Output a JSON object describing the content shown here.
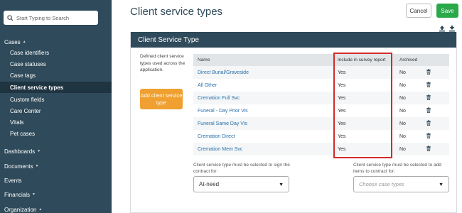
{
  "sidebar": {
    "search_placeholder": "Start Typing to Search",
    "sections": {
      "cases": "Cases",
      "dashboards": "Dashboards",
      "documents": "Documents",
      "events": "Events",
      "financials": "Financials",
      "organization": "Organization"
    },
    "case_items": [
      "Case identifiers",
      "Case statuses",
      "Case tags",
      "Client service types",
      "Custom fields",
      "Care Center",
      "Vitals",
      "Pet cases"
    ]
  },
  "header": {
    "title": "Client service types",
    "cancel_label": "Cancel",
    "save_label": "Save"
  },
  "panel": {
    "title": "Client Service Type",
    "description": "Defined client service types used across the application.",
    "add_button": "Add client service type",
    "columns": [
      "Name",
      "Include in survey report",
      "Archived"
    ],
    "rows": [
      {
        "name": "Direct Burial/Graveside",
        "include": "Yes",
        "archived": "No"
      },
      {
        "name": "All Other",
        "include": "Yes",
        "archived": "No"
      },
      {
        "name": "Cremation Full Svc",
        "include": "Yes",
        "archived": "No"
      },
      {
        "name": "Funeral - Day Prior Vis",
        "include": "Yes",
        "archived": "No"
      },
      {
        "name": "Funeral Same Day Vis",
        "include": "Yes",
        "archived": "No"
      },
      {
        "name": "Cremation Direct",
        "include": "Yes",
        "archived": "No"
      },
      {
        "name": "Cremation Mem Svc",
        "include": "Yes",
        "archived": "No"
      }
    ],
    "sign_label": "Client service type must be selected to sign the contract for:",
    "sign_value": "At-need",
    "add_items_label": "Client service type must be selected to add items to contract for:",
    "add_items_placeholder": "Choose case types"
  },
  "colors": {
    "sidebar_bg": "#2f4a5a",
    "save_green": "#2aa84a",
    "add_orange": "#f0a030",
    "highlight_red": "#d42a2a"
  }
}
